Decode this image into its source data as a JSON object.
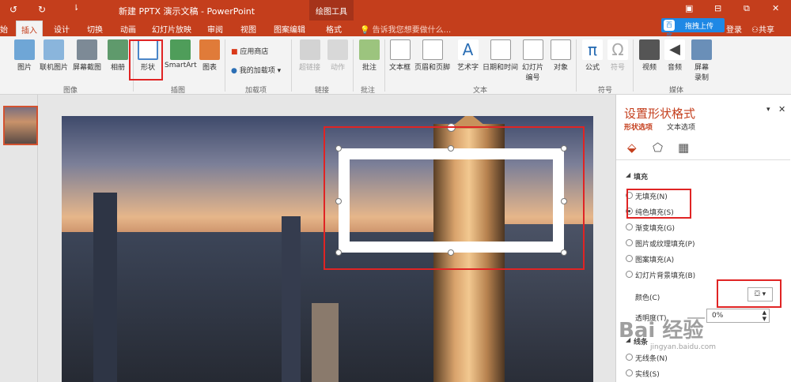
{
  "window": {
    "title": "新建 PPTX 演示文稿 - PowerPoint",
    "contextual_tab": "绘图工具",
    "min": "⊟",
    "restore": "⧉",
    "close": "✕"
  },
  "tabs": [
    "始",
    "插入",
    "设计",
    "切换",
    "动画",
    "幻灯片放映",
    "审阅",
    "视图",
    "图案编辑",
    "格式"
  ],
  "tell_me": "告诉我您想要做什么...",
  "account": {
    "upload": "拖拽上传",
    "baidu": "百度",
    "login": "登录",
    "share": "共享"
  },
  "ribbon": {
    "buttons": [
      "图片",
      "联机图片",
      "屏幕截图",
      "相册",
      "形状",
      "SmartArt",
      "图表",
      "应用商店",
      "我的加载项",
      "超链接",
      "动作",
      "批注",
      "文本框",
      "页眉和页脚",
      "艺术字",
      "日期和时间",
      "幻灯片\n编号",
      "对象",
      "公式",
      "符号",
      "视频",
      "音频",
      "屏幕\n录制"
    ],
    "groups": [
      "图像",
      "插图",
      "加载项",
      "链接",
      "批注",
      "文本",
      "符号",
      "媒体"
    ]
  },
  "slide_number": "1",
  "panel": {
    "title": "设置形状格式",
    "tab_shape": "形状选项",
    "tab_text": "文本选项",
    "section_fill": "填充",
    "options": [
      "无填充(N)",
      "纯色填充(S)",
      "渐变填充(G)",
      "图片或纹理填充(P)",
      "图案填充(A)",
      "幻灯片背景填充(B)"
    ],
    "selected_option": "纯色填充(S)",
    "color_label": "颜色(C)",
    "transparency_label": "透明度(T)",
    "transparency_value": "0%",
    "section_line": "线条",
    "line_options": [
      "无线条(N)",
      "实线(S)"
    ]
  },
  "watermark": "Bai 经验",
  "watermark_url": "jingyan.baidu.com",
  "colors": {
    "accent": "#c43e1c",
    "highlight": "#e02424"
  }
}
